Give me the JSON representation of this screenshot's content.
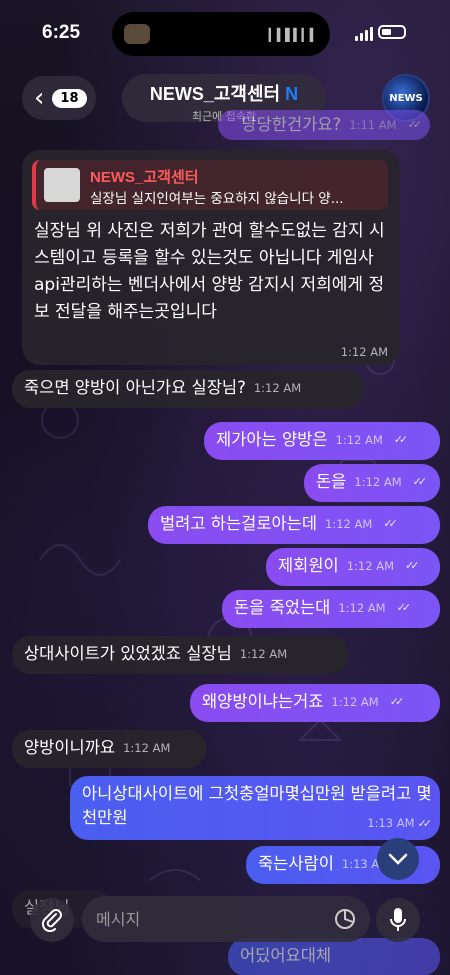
{
  "status": {
    "time": "6:25"
  },
  "header": {
    "back_count": "18",
    "title_main": "NEWS_고객센터",
    "title_badge": "N",
    "subtitle": "최근에 접속함",
    "avatar_text": "NEWS"
  },
  "prev_msg": {
    "text": "당당한건가요?",
    "time": "1:11 AM"
  },
  "reply_msg": {
    "quote_name": "NEWS_고객센터",
    "quote_text": "실장님 실지인여부는 중요하지 않습니다 양...",
    "body": "실장님 위 사진은 저희가 관여 할수도없는 감지 시스템이고 등록을 할수 있는것도 아닙니다 게임사api관리하는 벤더사에서 양방 감지시 저희에게 정보 전달을 해주는곳입니다",
    "time": "1:12 AM"
  },
  "messages": [
    {
      "text": "죽으면 양방이 아닌가요 실장님?",
      "time": "1:12 AM"
    },
    {
      "text": "제가아는 양방은",
      "time": "1:12 AM"
    },
    {
      "text": "돈을",
      "time": "1:12 AM"
    },
    {
      "text": "벌려고 하는걸로아는데",
      "time": "1:12 AM"
    },
    {
      "text": "제회원이",
      "time": "1:12 AM"
    },
    {
      "text": "돈을 죽었는대",
      "time": "1:12 AM"
    },
    {
      "text": "상대사이트가 있었겠죠 실장님",
      "time": "1:12 AM"
    },
    {
      "text": "왜양방이냐는거죠",
      "time": "1:12 AM"
    },
    {
      "text": "양방이니까요",
      "time": "1:12 AM"
    },
    {
      "text": "아니상대사이트에 그첫충얼마몇십만원 받을려고 몇천만원",
      "time": "1:13 AM"
    },
    {
      "text": "죽는사람이",
      "time": "1:13 AM"
    },
    {
      "text": "어딨어요대체",
      "time": ""
    },
    {
      "text": "실장님",
      "time": ""
    }
  ],
  "input": {
    "placeholder": "메시지"
  },
  "colors": {
    "outgoing_purple": "#8a4cf0",
    "outgoing_blue": "#4a5ef0",
    "incoming": "#28242c",
    "quote_accent": "#e0394a",
    "title_badge": "#1e7dff"
  }
}
